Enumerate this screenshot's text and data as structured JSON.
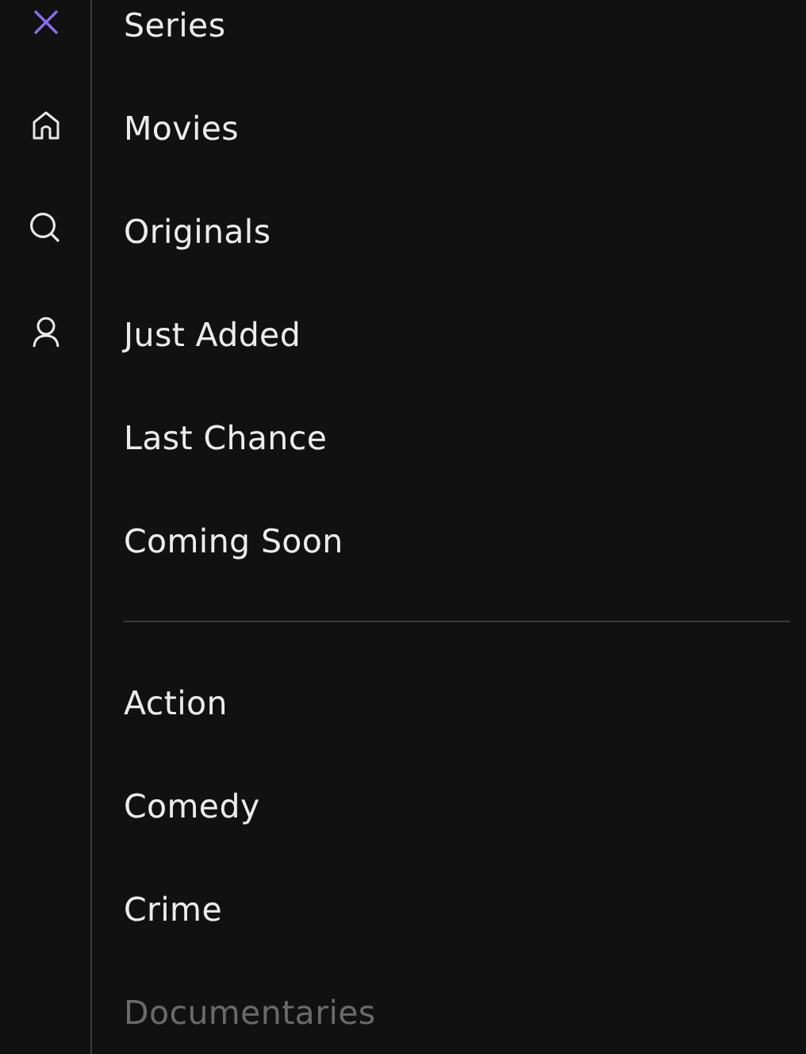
{
  "rail": [
    {
      "kind": "close"
    },
    {
      "kind": "home"
    },
    {
      "kind": "search"
    },
    {
      "kind": "profile"
    }
  ],
  "sections": [
    {
      "items": [
        {
          "label": "Series",
          "faded": false
        },
        {
          "label": "Movies",
          "faded": false
        },
        {
          "label": "Originals",
          "faded": false
        },
        {
          "label": "Just Added",
          "faded": false
        },
        {
          "label": "Last Chance",
          "faded": false
        },
        {
          "label": "Coming Soon",
          "faded": false
        }
      ]
    },
    {
      "items": [
        {
          "label": "Action",
          "faded": false
        },
        {
          "label": "Comedy",
          "faded": false
        },
        {
          "label": "Crime",
          "faded": false
        },
        {
          "label": "Documentaries",
          "faded": true
        }
      ]
    }
  ]
}
